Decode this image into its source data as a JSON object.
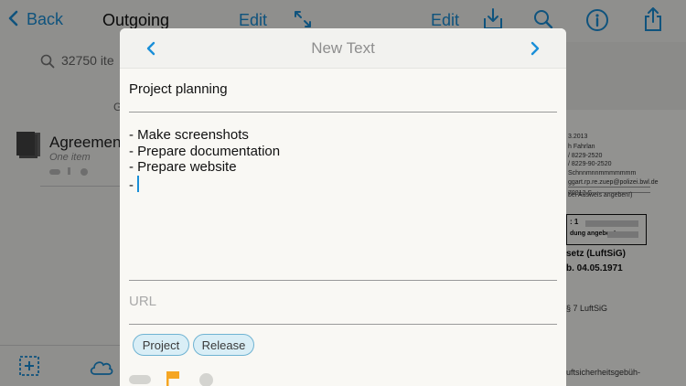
{
  "background": {
    "back_label": "Back",
    "list_title": "Outgoing",
    "left_edit_label": "Edit",
    "right_edit_label": "Edit",
    "search_text": "32750 ite",
    "section_letter": "G",
    "item_title": "Agreemen",
    "item_subtitle": "One item",
    "doc_lines": [
      "3.2013",
      "h Fahrlan",
      "/ 8229-2520",
      "/ 8229-90-2520",
      "Schnnmnnmmmmmmm",
      "ggart.rp.re.zuep@polizei.bwl.de",
      "70313 S",
      "bei Ausweis angeben!)"
    ],
    "doc_bold_lines": [
      ": 1",
      "dung angeben!",
      "setz (LuftSiG)",
      "b. 04.05.1971",
      "§ 7 LuftSiG",
      "uftsicherheitsgebüh-"
    ]
  },
  "modal": {
    "title": "New Text",
    "prev_icon": "chevron-left-icon",
    "next_icon": "chevron-right-icon",
    "text_title": "Project planning",
    "body_lines": [
      "- Make screenshots",
      "- Prepare documentation",
      "- Prepare website",
      "-"
    ],
    "url_placeholder": "URL",
    "tags": [
      "Project",
      "Release"
    ],
    "flag_color": "#f5a623"
  },
  "colors": {
    "accent": "#1a8fd8",
    "tag_border": "#6fb3d2",
    "tag_fill": "#d9eef6"
  }
}
